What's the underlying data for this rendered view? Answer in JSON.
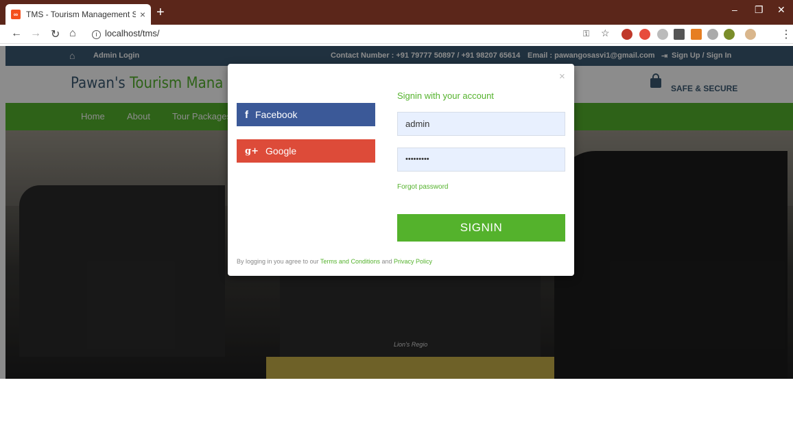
{
  "browser": {
    "tab_title": "TMS - Tourism Management Syst",
    "tab_close": "×",
    "new_tab": "+",
    "url": "localhost/tms/",
    "controls": {
      "minimize": "–",
      "restore": "❐",
      "close": "✕"
    },
    "icons": [
      "back-icon",
      "forward-icon",
      "reload-icon",
      "home-icon",
      "info-icon",
      "key-icon",
      "bookmark-star-icon",
      "menu-icon"
    ]
  },
  "topbar": {
    "admin_login": "Admin Login",
    "contact": "Contact Number : +91 79777 50897 / +91 98207 65614",
    "email": "Email : pawangosasvi1@gmail.com",
    "signup": "Sign Up / Sign In"
  },
  "header": {
    "brand_part1": "Pawan's ",
    "brand_part2": "Tourism Mana",
    "safe": "SAFE & SECURE"
  },
  "nav": {
    "items": [
      "Home",
      "About",
      "Tour Packages"
    ]
  },
  "hero": {
    "bus_text": "Lion's Regio"
  },
  "modal": {
    "close": "×",
    "facebook": "Facebook",
    "google": "Google",
    "heading": "Signin with your account",
    "username_value": "admin",
    "password_value": "•••••••••",
    "forgot": "Forgot password",
    "signin": "SIGNIN",
    "terms_prefix": "By logging in you agree to our ",
    "terms_link": "Terms and Conditions",
    "terms_and": " and ",
    "privacy_link": "Privacy Policy"
  },
  "colors": {
    "green": "#54b22c",
    "facebook": "#3b5998",
    "google": "#dd4b39",
    "topbar": "#3b5a73",
    "chrome": "#5b261a"
  }
}
